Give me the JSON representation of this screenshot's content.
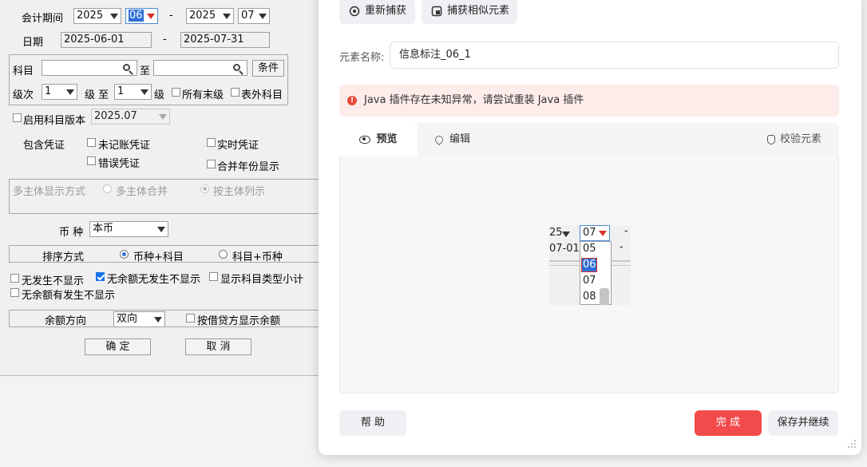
{
  "legacy": {
    "period_label": "会计期间",
    "period_from_year": "2025",
    "period_from_month": "06",
    "period_dash": "-",
    "period_to_year": "2025",
    "period_to_month": "07",
    "date_label": "日期",
    "date_from": "2025-06-01",
    "date_dash": "-",
    "date_to": "2025-07-31",
    "subject_label": "科目",
    "subject_to": "至",
    "condition_button": "条件",
    "level_label": "级次",
    "level_from": "1",
    "level_mid": "级 至",
    "level_to": "1",
    "level_suffix": "级",
    "all_leaf_label": "所有末级",
    "off_sheet_label": "表外科目",
    "enable_version_label": "启用科目版本",
    "version_value": "2025.07",
    "include_voucher_label": "包含凭证",
    "unposted_label": "未记账凭证",
    "realtime_label": "实时凭证",
    "error_label": "错误凭证",
    "merge_year_label": "合并年份显示",
    "multi_entity_label": "多主体显示方式",
    "multi_merge_label": "多主体合并",
    "multi_column_label": "按主体列示",
    "currency_label": "币 种",
    "currency_value": "本币",
    "sort_label": "排序方式",
    "sort_opt1": "币种+科目",
    "sort_opt2": "科目+币种",
    "no_occur_label": "无发生不显示",
    "no_balance_no_occur_label": "无余额无发生不显示",
    "show_type_subtotal_label": "显示科目类型小计",
    "no_balance_has_occur_label": "无余额有发生不显示",
    "balance_dir_label": "余额方向",
    "balance_dir_value": "双向",
    "by_dc_label": "按借贷方显示余额",
    "ok_button": "确 定",
    "cancel_button": "取 消"
  },
  "panel": {
    "recapture_button": "重新捕获",
    "capture_similar_button": "捕获相似元素",
    "element_name_label": "元素名称:",
    "element_name_value": "信息标注_06_1",
    "alert_text": "Java 插件存在未知异常，请尝试重装 Java 插件",
    "tab_preview": "预览",
    "tab_edit": "编辑",
    "verify_button": "校验元素",
    "help_button": "帮 助",
    "finish_button": "完 成",
    "save_continue_button": "保存并继续"
  },
  "preview_crop": {
    "year_fragment": "25",
    "month_selected": "07",
    "dash": "-",
    "date_fragment": "07-01",
    "options": [
      "05",
      "06",
      "07",
      "08"
    ],
    "highlighted_option": "06"
  },
  "colors": {
    "finish_red": "#f24b4b",
    "alert_bg": "#fdecea",
    "checkbox_blue": "#1a73e8",
    "highlight_blue": "#2f6fd6"
  }
}
